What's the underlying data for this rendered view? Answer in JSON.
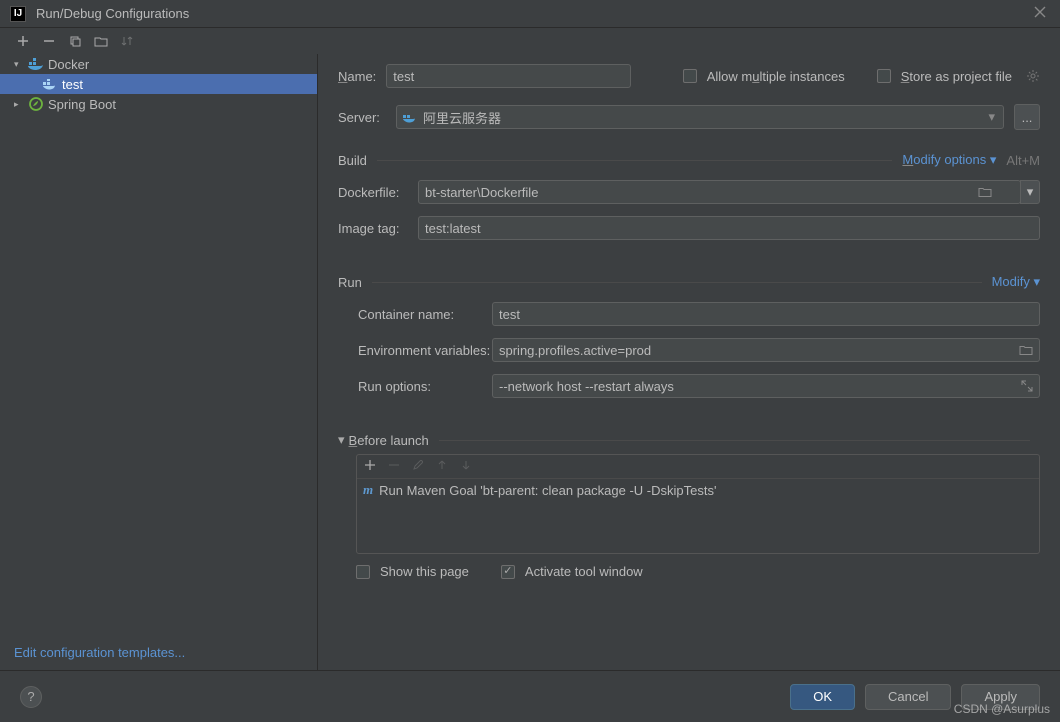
{
  "title": "Run/Debug Configurations",
  "tree": {
    "docker_label": "Docker",
    "docker_child": "test",
    "spring_label": "Spring Boot"
  },
  "edit_templates": "Edit configuration templates...",
  "form": {
    "name_label": "Name:",
    "name_value": "test",
    "allow_multiple": "Allow multiple instances",
    "store_project": "Store as project file",
    "server_label": "Server:",
    "server_value": "阿里云服务器",
    "server_more": "..."
  },
  "build": {
    "title": "Build",
    "modify": "Modify options",
    "shortcut": "Alt+M",
    "dockerfile_label": "Dockerfile:",
    "dockerfile_value": "bt-starter\\Dockerfile",
    "imagetag_label": "Image tag:",
    "imagetag_value": "test:latest"
  },
  "run": {
    "title": "Run",
    "modify": "Modify",
    "container_label": "Container name:",
    "container_value": "test",
    "env_label": "Environment variables:",
    "env_value": "spring.profiles.active=prod",
    "runopt_label": "Run options:",
    "runopt_value": "--network host --restart always"
  },
  "before": {
    "title": "Before launch",
    "item": "Run Maven Goal 'bt-parent: clean package -U -DskipTests'",
    "show_page": "Show this page",
    "activate_tool": "Activate tool window"
  },
  "footer": {
    "ok": "OK",
    "cancel": "Cancel",
    "apply": "Apply"
  },
  "watermark": "CSDN @Asurplus"
}
